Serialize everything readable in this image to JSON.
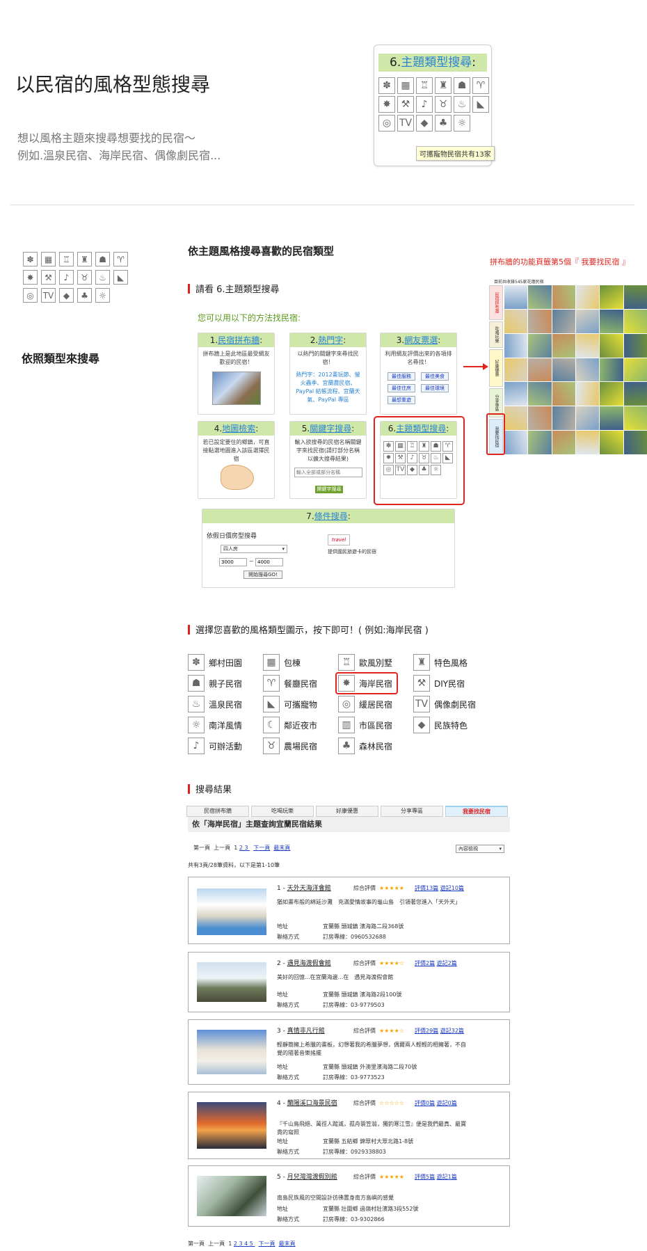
{
  "hero": {
    "title": "以民宿的風格型態搜尋",
    "subtitle1": "想以風格主題來搜尋想要找的民宿～",
    "subtitle2": "例如.溫泉民宿、海岸民宿、偶像劇民宿...",
    "panel_title_num": "6.",
    "panel_title_link": "主題類型搜尋",
    "panel_title_colon": ":",
    "tooltip": "可攜寵物民宿共有13家"
  },
  "left": {
    "heading": "依照類型來搜尋"
  },
  "main": {
    "heading": "依主題風格搜尋喜歡的民宿類型",
    "see_label": "請看 6.主題類型搜尋",
    "methods_label": "您可以用以下的方法找民宿:",
    "side_note_prefix": "拼布牆的功能頁籤第5個『 ",
    "side_note_highlight": "我要找民宿",
    "side_note_suffix": " 』",
    "screenshot_header": "目前共收錄545家花蓮民宿",
    "vertical_tabs": [
      "民宿拼布牆",
      "吃喝玩樂",
      "好康優惠",
      "分享專區",
      "我要找民宿"
    ]
  },
  "boxes": {
    "b1": {
      "num": "1.",
      "link": "民宿拼布牆",
      "colon": ":",
      "text": "拼布牆上是此地區最受網友歡迎的民宿！"
    },
    "b2": {
      "num": "2.",
      "link": "熱門字",
      "colon": ":",
      "text": "以熱門的關鍵字來尋找民宿！",
      "hot": "熱門字：2012畫玩節、螢火蟲季、宜蘭農民宿、PayPal 結帳流程、宜蘭天氣、PayPal 專區"
    },
    "b3": {
      "num": "3.",
      "link": "網友票選",
      "colon": ":",
      "text": "利用網友評價出來的各項排名尋找！",
      "btns": [
        "最佳服務",
        "最佳美食",
        "最佳住房",
        "最佳環境",
        "最想重遊"
      ]
    },
    "b4": {
      "num": "4.",
      "link": "地圖檢索",
      "colon": ":",
      "text": "若已設定要住的鄉鎮，可直接點選地圖進入該區選擇民宿"
    },
    "b5": {
      "num": "5.",
      "link": "關鍵字搜尋",
      "colon": ":",
      "text": "輸入欲搜尋的民宿名稱關鍵字來找民宿(請打部分名稱以擴大搜尋結果)",
      "placeholder": "輸入全部或部分名稱",
      "btn": "開鍵字搜尋"
    },
    "b6": {
      "num": "6.",
      "link": "主題類型搜尋",
      "colon": ":"
    },
    "b7": {
      "num": "7.",
      "link": "條件搜尋",
      "colon": ":",
      "label": "依假日價房型搜尋",
      "select": "四人房",
      "min": "3000",
      "tilde": "~",
      "max": "4000",
      "btn": "開始搜尋GO!",
      "badge": "travel",
      "badge_text": "提供國民旅遊卡的民宿"
    }
  },
  "select_section": {
    "heading": "選擇您喜歡的風格類型圖示，按下即可！( 例如:海岸民宿 )",
    "categories": [
      {
        "label": "鄉村田園",
        "icon": "flower-icon",
        "glyph": "✽"
      },
      {
        "label": "包棟",
        "icon": "building-icon",
        "glyph": "▦"
      },
      {
        "label": "歐風別墅",
        "icon": "villa-icon",
        "glyph": "♖"
      },
      {
        "label": "特色風格",
        "icon": "castle-icon",
        "glyph": "♜"
      },
      {
        "label": "親子民宿",
        "icon": "family-icon",
        "glyph": "☗"
      },
      {
        "label": "餐廳民宿",
        "icon": "cutlery-icon",
        "glyph": "♈"
      },
      {
        "label": "海岸民宿",
        "icon": "palm-tree-icon",
        "glyph": "✸"
      },
      {
        "label": "DIY民宿",
        "icon": "tools-icon",
        "glyph": "⚒"
      },
      {
        "label": "溫泉民宿",
        "icon": "hot-spring-icon",
        "glyph": "♨"
      },
      {
        "label": "可攜寵物",
        "icon": "dog-icon",
        "glyph": "◣"
      },
      {
        "label": "緩居民宿",
        "icon": "snail-icon",
        "glyph": "◎"
      },
      {
        "label": "偶像劇民宿",
        "icon": "tv-icon",
        "glyph": "TV"
      },
      {
        "label": "南洋風情",
        "icon": "tropical-icon",
        "glyph": "☼"
      },
      {
        "label": "鄰近夜市",
        "icon": "night-market-icon",
        "glyph": "☾"
      },
      {
        "label": "市區民宿",
        "icon": "city-icon",
        "glyph": "▥"
      },
      {
        "label": "民族特色",
        "icon": "elephant-icon",
        "glyph": "◆"
      },
      {
        "label": "可辦活動",
        "icon": "music-icon",
        "glyph": "♪"
      },
      {
        "label": "農場民宿",
        "icon": "farm-icon",
        "glyph": "♉"
      },
      {
        "label": "森林民宿",
        "icon": "forest-icon",
        "glyph": "♣"
      }
    ]
  },
  "results": {
    "heading": "搜尋結果",
    "tabs": [
      "民宿拼布牆",
      "吃喝玩樂",
      "好康優惠",
      "分享專區",
      "我要找民宿"
    ],
    "subtitle": "依「海岸民宿」主題查詢宜蘭民宿結果",
    "pag_first": "第一頁",
    "pag_prev": "上一頁",
    "pag_cur": "1",
    "pag_pages_top": [
      "2",
      "3"
    ],
    "pag_next": "下一頁",
    "pag_last": "最末頁",
    "sort": "內容檢視",
    "summary": "共有3頁/28筆資料，以下是第1-10筆",
    "pag_pages_bottom": [
      "2",
      "3",
      "4",
      "5"
    ],
    "rating_label": "綜合評價",
    "addr_label": "地址",
    "contact_label": "聯絡方式",
    "items": [
      {
        "idx": "1 - ",
        "name": "天外天海洋會館",
        "stars": "★★★★★",
        "reviews": "評價13篇",
        "diaries": "遊記10篇",
        "desc": "猶如畫布般的綿延沙灘　充滿愛情故事的龜山島　引領著您進入「天外天」",
        "addr": "宜蘭縣 頭城鎮 濱海路二段368號",
        "phone": "訂房專線：0960532688"
      },
      {
        "idx": "2 - ",
        "name": "遇見海渡假會館",
        "stars": "★★★★☆",
        "reviews": "評價2篇",
        "diaries": "遊記2篇",
        "desc": "美好的回憶...在宜蘭海邊...在　遇見海渡假會館",
        "addr": "宜蘭縣 頭城鎮 濱海路2段100號",
        "phone": "訂房專線：03-9779503"
      },
      {
        "idx": "3 - ",
        "name": "真情非凡行館",
        "stars": "★★★★☆",
        "reviews": "評價29篇",
        "diaries": "遊記32篇",
        "desc": "輕靜簡擁上希臘的畫板，幻想著我的希臘夢想，偶爾兩人輕輕的相擁著，不自覺的隨著音樂搖擺",
        "addr": "宜蘭縣 頭城鎮 外澳里濱海路二段70號",
        "phone": "訂房專線：03-9773523"
      },
      {
        "idx": "4 - ",
        "name": "蘭陽溪口海景民宿",
        "stars": "☆☆☆☆☆",
        "reviews": "評價0篇",
        "diaries": "遊記0篇",
        "desc": "『千山鳥飛絕、萬徑人蹤滅，孤舟簑笠翁，獨釣寒江雪』便是我們最真、最寶貴的寫照",
        "addr": "宜蘭縣 五結鄉 錦眾村大眾北路1-8號",
        "phone": "訂房專線：0929338803"
      },
      {
        "idx": "5 - ",
        "name": "月兒灣灣渡假別館",
        "stars": "★★★★★",
        "reviews": "評價5篇",
        "diaries": "遊記1篇",
        "desc": "南島民族風的空間設計彷彿置身南方島嶼的感覺",
        "addr": "宜蘭縣 壯圍鄉 過嶺村壯濱路3段552號",
        "phone": "訂房專線：03-9302866"
      }
    ]
  }
}
